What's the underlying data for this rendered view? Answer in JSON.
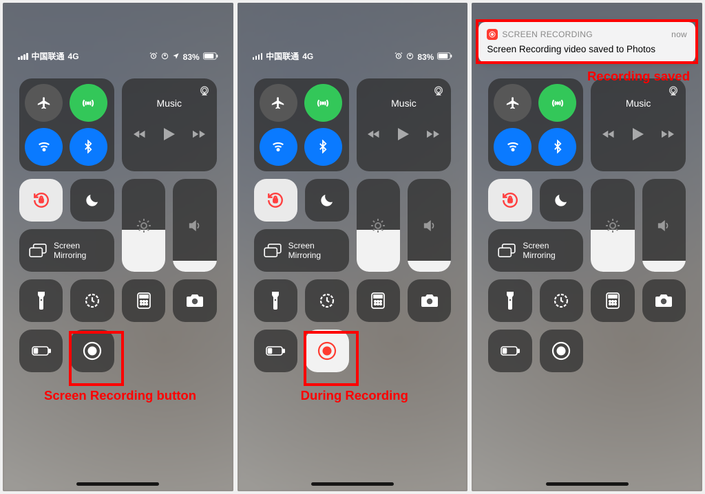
{
  "status": {
    "carrier": "中国联通",
    "network": "4G",
    "battery1": "83%",
    "battery2": "83%"
  },
  "music": {
    "label": "Music"
  },
  "mirror": {
    "line1": "Screen",
    "line2": "Mirroring"
  },
  "notification": {
    "app": "SCREEN RECORDING",
    "time": "now",
    "msg": "Screen Recording video saved to Photos"
  },
  "annotations": {
    "p1": "Screen Recording button",
    "p2": "During Recording",
    "p3": "Recording saved"
  },
  "brightness_pct": 45,
  "volume_pct": 12
}
